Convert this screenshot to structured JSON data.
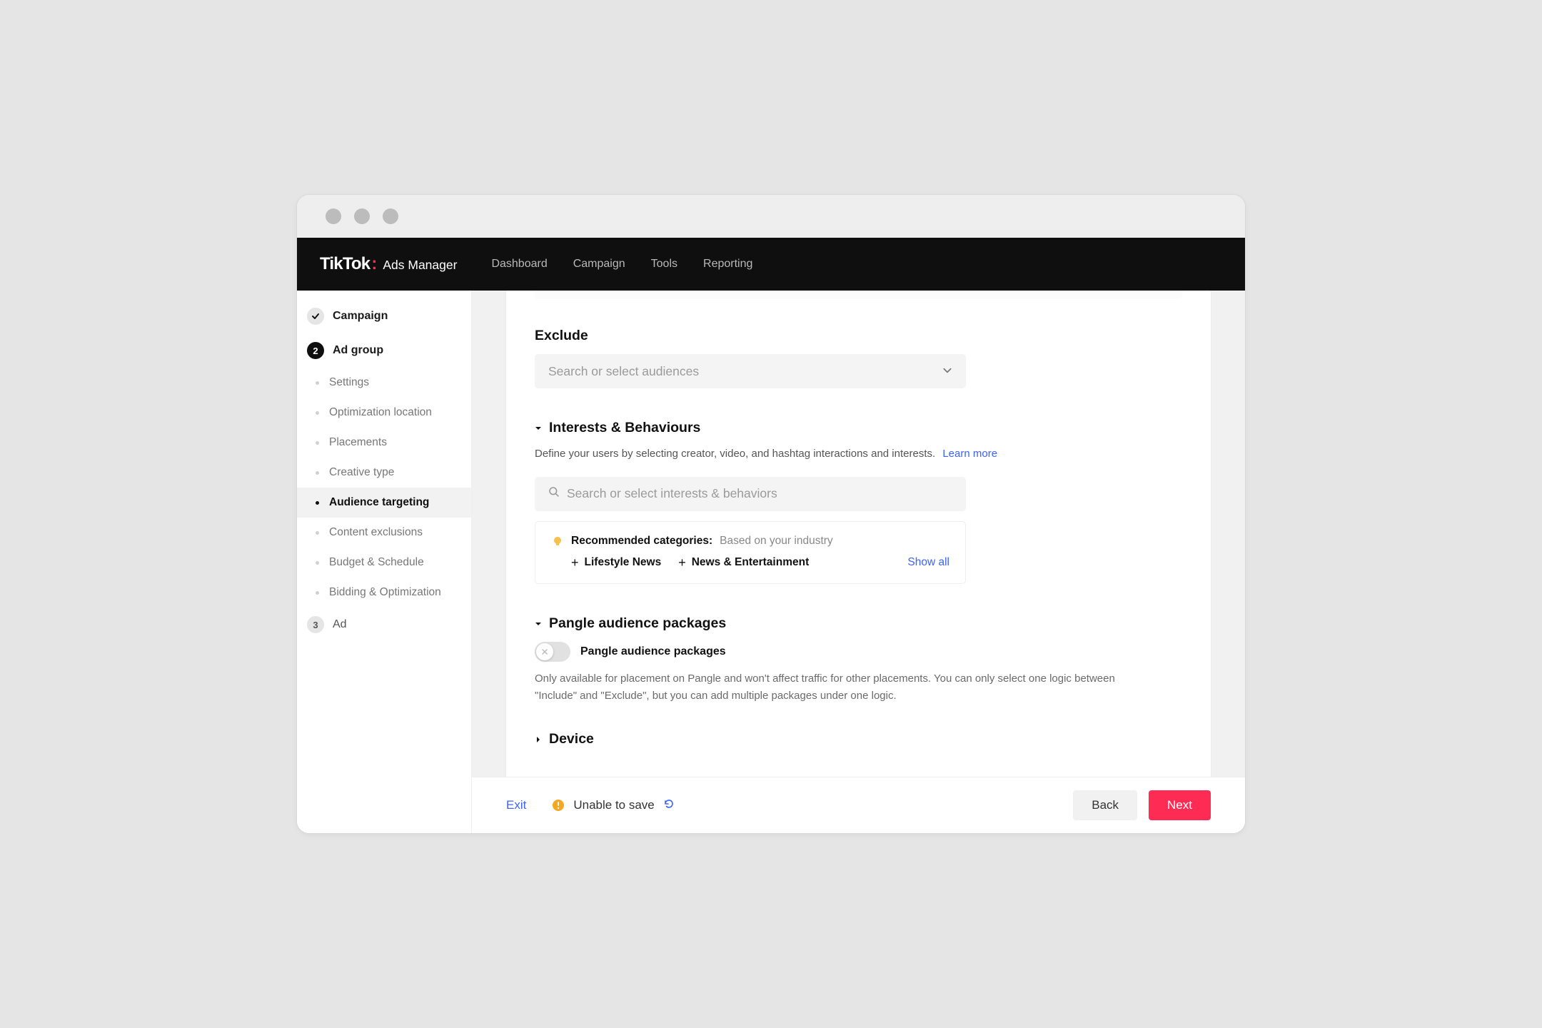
{
  "app": {
    "logo_main": "TikTok",
    "logo_colon": ":",
    "logo_sub": "Ads Manager"
  },
  "header_nav": [
    "Dashboard",
    "Campaign",
    "Tools",
    "Reporting"
  ],
  "sidebar": {
    "campaign": {
      "label": "Campaign"
    },
    "ad_group": {
      "label": "Ad group",
      "num": "2"
    },
    "sub_items": [
      {
        "label": "Settings"
      },
      {
        "label": "Optimization location"
      },
      {
        "label": "Placements"
      },
      {
        "label": "Creative type"
      },
      {
        "label": "Audience targeting",
        "active": true
      },
      {
        "label": "Content exclusions"
      },
      {
        "label": "Budget & Schedule"
      },
      {
        "label": "Bidding & Optimization"
      }
    ],
    "ad": {
      "label": "Ad",
      "num": "3"
    }
  },
  "exclude": {
    "heading": "Exclude",
    "placeholder": "Search or select audiences"
  },
  "interests": {
    "heading": "Interests & Behaviours",
    "desc": "Define your users by selecting creator, video, and hashtag interactions and interests.",
    "learn_more": "Learn more",
    "placeholder": "Search or select interests & behaviors",
    "rec_title": "Recommended categories:",
    "rec_sub": "Based on your industry",
    "chips": [
      "Lifestyle News",
      "News & Entertainment"
    ],
    "show_all": "Show all"
  },
  "pangle": {
    "heading": "Pangle audience packages",
    "toggle_label": "Pangle audience packages",
    "note": "Only available for placement on Pangle and won't affect traffic for other placements. You can only select one logic between \"Include\" and \"Exclude\", but you can add multiple packages under one logic."
  },
  "device": {
    "heading": "Device"
  },
  "footer": {
    "exit": "Exit",
    "status": "Unable to save",
    "back": "Back",
    "next": "Next"
  }
}
